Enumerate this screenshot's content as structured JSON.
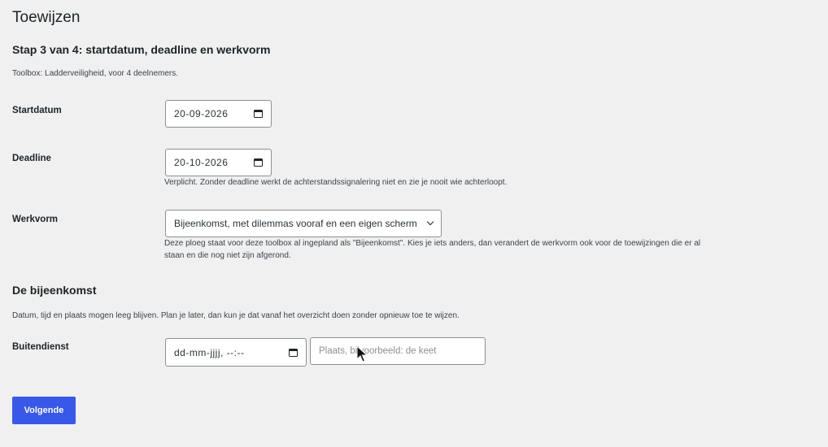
{
  "page": {
    "title": "Toewijzen",
    "step_title": "Stap 3 van 4: startdatum, deadline en werkvorm",
    "intro": "Toolbox: Ladderveiligheid, voor 4 deelnemers."
  },
  "form": {
    "startdatum": {
      "label": "Startdatum",
      "value": "20-09-2026"
    },
    "deadline": {
      "label": "Deadline",
      "value": "20-10-2026",
      "help": "Verplicht. Zonder deadline werkt de achterstandssignalering niet en zie je nooit wie achterloopt."
    },
    "werkvorm": {
      "label": "Werkvorm",
      "selected": "Bijeenkomst, met dilemmas vooraf en een eigen scherm",
      "help_line1": "Deze ploeg staat voor deze toolbox al ingepland als \"Bijeenkomst\". Kies je iets anders, dan verandert de werkvorm ook voor de toewijzingen die er al",
      "help_line2": "staan en die nog niet zijn afgerond."
    }
  },
  "bijeenkomst": {
    "title": "De bijeenkomst",
    "intro": "Datum, tijd en plaats mogen leeg blijven. Plan je later, dan kun je dat vanaf het overzicht doen zonder opnieuw toe te wijzen.",
    "buitendienst": {
      "label": "Buitendienst",
      "datetime_placeholder": "dd-mm-jjjj, --:--",
      "place_placeholder": "Plaats, bijvoorbeeld: de keet"
    }
  },
  "actions": {
    "next_label": "Volgende"
  },
  "colors": {
    "background": "#f0f0f1",
    "primary_button": "#3858e9",
    "text": "#1d2327",
    "border": "#8c8f94"
  },
  "icons": {
    "calendar": "calendar-icon",
    "select_chevron": "chevron-down-icon",
    "cursor": "mouse-pointer-icon"
  }
}
